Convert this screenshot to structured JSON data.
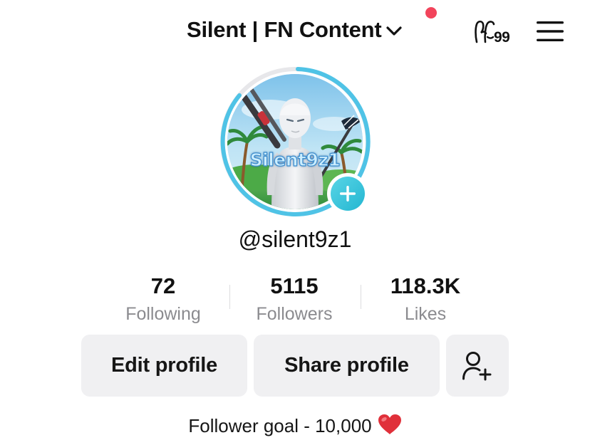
{
  "header": {
    "account_name": "Silent | FN Content",
    "creator_tools_count": "99",
    "icons": {
      "switcher": "chevron-down-icon",
      "creator_tools": "creator-tools-icon",
      "menu": "hamburger-menu-icon"
    },
    "notification_color": "#f2445b"
  },
  "profile": {
    "avatar_text": "Silent9z1",
    "username": "@silent9z1",
    "ring_color": "#4fc3e6",
    "add_story_icon": "plus-icon"
  },
  "stats": [
    {
      "value": "72",
      "label": "Following"
    },
    {
      "value": "5115",
      "label": "Followers"
    },
    {
      "value": "118.3K",
      "label": "Likes"
    }
  ],
  "actions": {
    "edit_profile": "Edit profile",
    "share_profile": "Share profile",
    "add_friends_icon": "add-friend-icon"
  },
  "bio": {
    "text": "Follower goal - 10,000",
    "emoji": "heart-emoji"
  }
}
